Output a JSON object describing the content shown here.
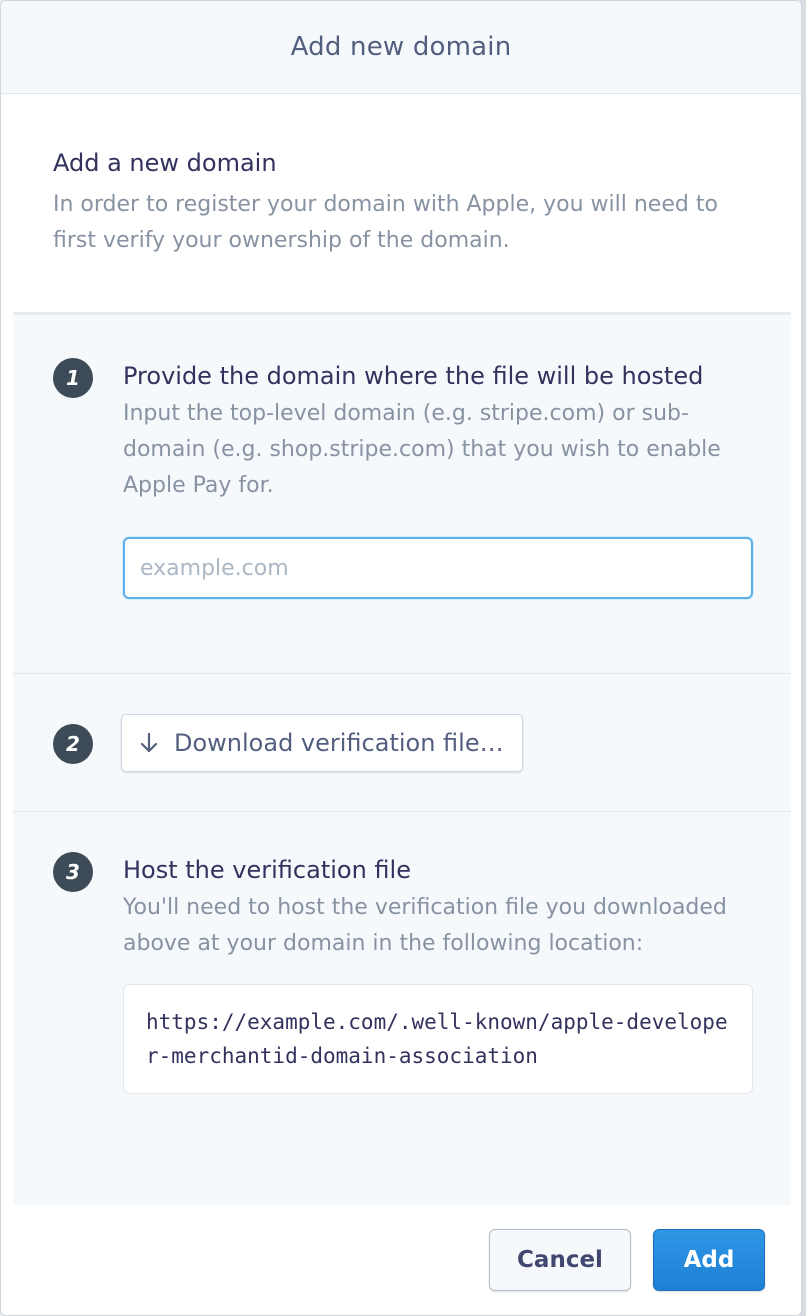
{
  "modal": {
    "title": "Add new domain"
  },
  "intro": {
    "title": "Add a new domain",
    "description": "In order to register your domain with Apple, you will need to first verify your ownership of the domain."
  },
  "steps": [
    {
      "number": "1",
      "title": "Provide the domain where the file will be hosted",
      "description": "Input the top-level domain (e.g. stripe.com) or sub-domain (e.g. shop.stripe.com) that you wish to enable Apple Pay for.",
      "input_placeholder": "example.com",
      "input_value": ""
    },
    {
      "number": "2",
      "button_label": "Download verification file…",
      "button_icon": "arrow-down-icon"
    },
    {
      "number": "3",
      "title": "Host the verification file",
      "description": "You'll need to host the verification file you downloaded above at your domain in the following location:",
      "code": "https://example.com/.well-known/apple-developer-merchantid-domain-association"
    }
  ],
  "footer": {
    "cancel_label": "Cancel",
    "add_label": "Add"
  },
  "colors": {
    "primary": "#1f7fd4",
    "step_badge": "#3c4b57",
    "focus_border": "#5ab0eb"
  }
}
